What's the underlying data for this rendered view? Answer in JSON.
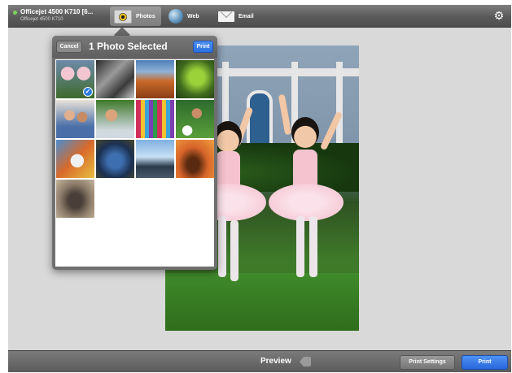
{
  "printer": {
    "name": "Officejet 4500 K710 [6...",
    "model": "Officejet 4500 K710"
  },
  "tabs": [
    {
      "label": "Photos",
      "icon": "photos-icon",
      "selected": true
    },
    {
      "label": "Web",
      "icon": "globe-icon",
      "selected": false
    },
    {
      "label": "Email",
      "icon": "envelope-icon",
      "selected": false
    }
  ],
  "settings_icon": "gear-icon",
  "popover": {
    "cancel_label": "Cancel",
    "title": "1 Photo Selected",
    "print_label": "Print",
    "photos_selected": 1,
    "thumbnail_count": 13
  },
  "bottom": {
    "preview_label": "Preview",
    "print_settings_label": "Print Settings",
    "print_label": "Print"
  },
  "colors": {
    "accent_blue": "#2f7de0",
    "bar_gray": "#5f5f5f",
    "status_green": "#7bd35a"
  }
}
